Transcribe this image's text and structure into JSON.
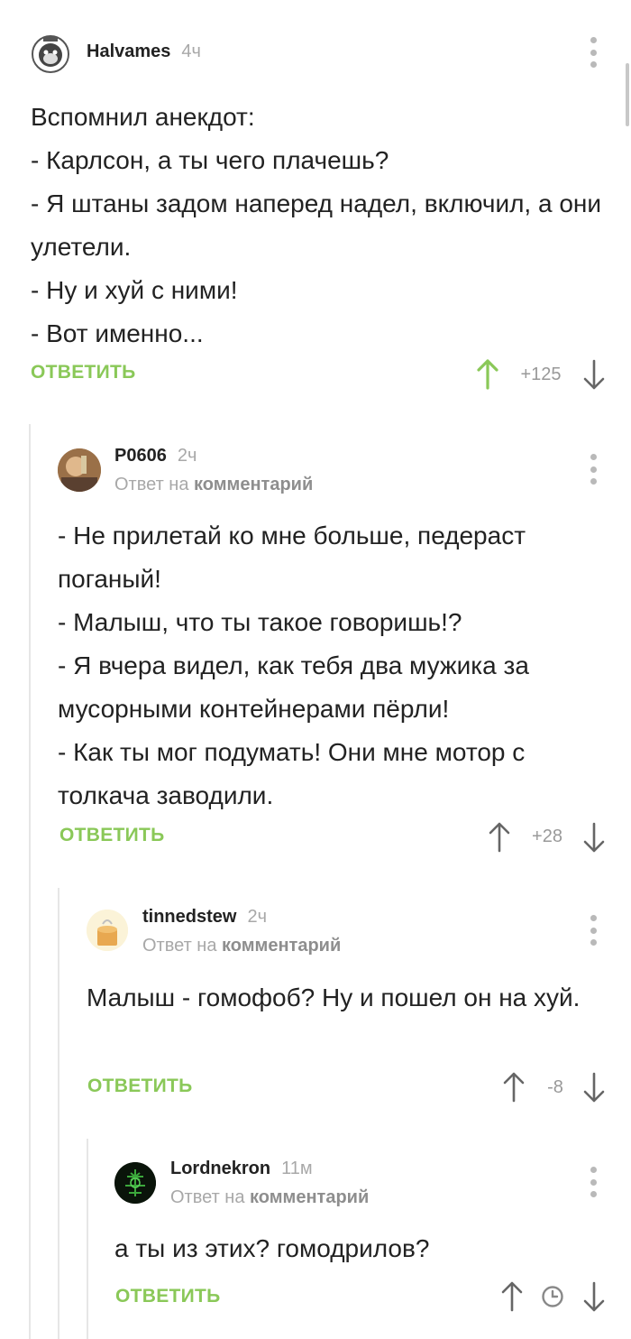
{
  "comments": [
    {
      "author": "Halvames",
      "time": "4ч",
      "reply_to_prefix": "",
      "reply_to_link": "",
      "text": "Вспомнил анекдот:\n- Карлсон, а ты чего плачешь?\n- Я штаны задом наперед надел, включил, а они улетели.\n- Ну и хуй с ними!\n- Вот именно...",
      "reply_label": "ОТВЕТИТЬ",
      "rating": "+125",
      "upvote_active": true
    },
    {
      "author": "P0606",
      "time": "2ч",
      "reply_to_prefix": "Ответ на",
      "reply_to_link": "комментарий",
      "text": "- Не прилетай ко мне больше, педераст поганый!\n- Малыш, что ты такое говоришь!?\n- Я вчера видел, как тебя два мужика за мусорными контейнерами пёрли!\n- Как ты мог подумать! Они мне мотор с толкача заводили.",
      "reply_label": "ОТВЕТИТЬ",
      "rating": "+28",
      "upvote_active": false
    },
    {
      "author": "tinnedstew",
      "time": "2ч",
      "reply_to_prefix": "Ответ на",
      "reply_to_link": "комментарий",
      "text": "Малыш - гомофоб? Ну и пошел он на хуй.",
      "reply_label": "ОТВЕТИТЬ",
      "rating": "-8",
      "upvote_active": false
    },
    {
      "author": "Lordnekron",
      "time": "11м",
      "reply_to_prefix": "Ответ на",
      "reply_to_link": "комментарий",
      "text": "а ты из этих? гомодрилов?",
      "reply_label": "ОТВЕТИТЬ",
      "rating": "",
      "rating_icon": "clock-icon",
      "upvote_active": false
    }
  ],
  "icons": {
    "upvote": "arrow-up-icon",
    "downvote": "arrow-down-icon",
    "menu": "kebab-menu-icon",
    "pending_rating": "clock-icon"
  },
  "colors": {
    "accent_green": "#8ac858",
    "text": "#222222",
    "muted": "#a8a8a8",
    "arrow": "#666666"
  }
}
